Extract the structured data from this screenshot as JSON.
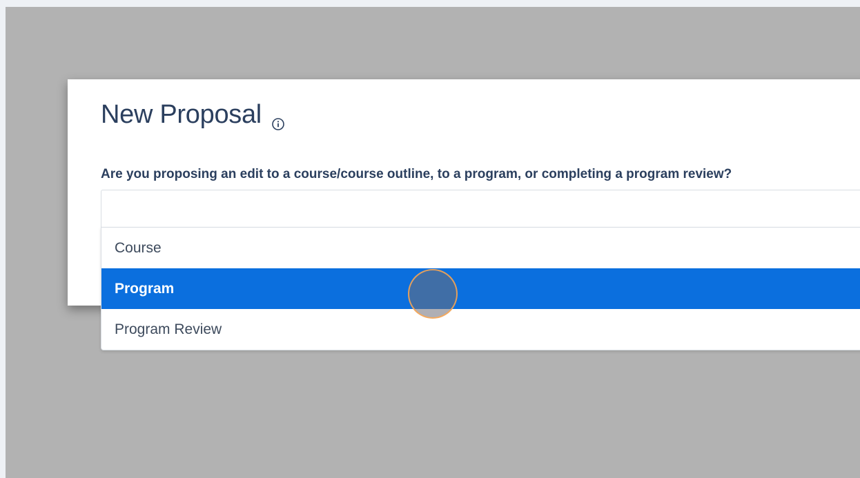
{
  "modal": {
    "title": "New Proposal",
    "info_icon": "info-circle-icon",
    "question": "Are you proposing an edit to a course/course outline, to a program, or completing a program review?"
  },
  "select": {
    "value": "",
    "options": [
      {
        "label": "Course",
        "selected": false
      },
      {
        "label": "Program",
        "selected": true
      },
      {
        "label": "Program Review",
        "selected": false
      }
    ]
  },
  "colors": {
    "backdrop": "#b2b2b2",
    "title_text": "#2b3f5e",
    "selected_option_bg": "#0b6fde",
    "click_indicator_ring": "#ffa850"
  }
}
